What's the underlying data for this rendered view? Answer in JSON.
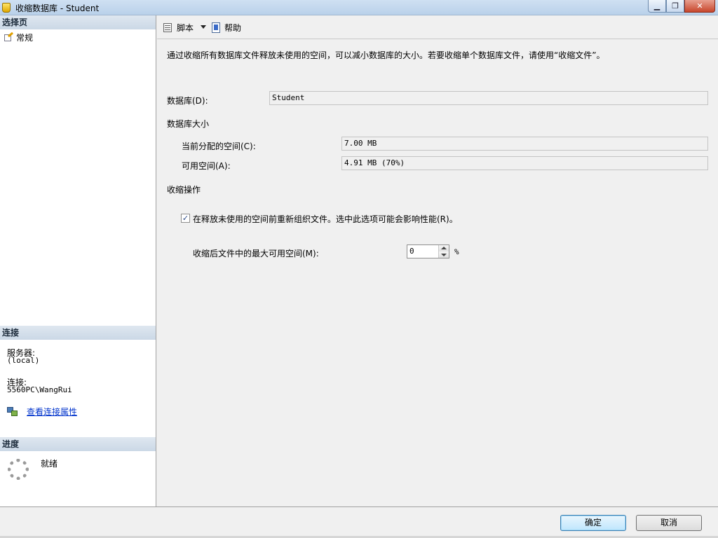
{
  "window": {
    "title": "收缩数据库 - Student",
    "min_glyph": "▁",
    "max_glyph": "❐",
    "close_glyph": "✕"
  },
  "left": {
    "select_page_header": "选择页",
    "pages": [
      {
        "label": "常规"
      }
    ],
    "connection_header": "连接",
    "server_label": "服务器:",
    "server_value": "(local)",
    "connection_label": "连接:",
    "connection_value": "5560PC\\WangRui",
    "view_properties_link": "查看连接属性",
    "progress_header": "进度",
    "progress_status": "就绪"
  },
  "toolbar": {
    "script_label": "脚本",
    "help_label": "帮助"
  },
  "main": {
    "description": "通过收缩所有数据库文件释放未使用的空间，可以减小数据库的大小。若要收缩单个数据库文件，请使用“收缩文件”。",
    "database_label": "数据库(D):",
    "database_value": "Student",
    "size_section": "数据库大小",
    "allocated_label": "当前分配的空间(C):",
    "allocated_value": "7.00 MB",
    "available_label": "可用空间(A):",
    "available_value": "4.91 MB (70%)",
    "shrink_section": "收缩操作",
    "reorganize_checked": true,
    "reorganize_check_glyph": "✓",
    "reorganize_label": "在释放未使用的空间前重新组织文件。选中此选项可能会影响性能(R)。",
    "max_free_label": "收缩后文件中的最大可用空间(M):",
    "max_free_value": "0",
    "max_free_unit": "%"
  },
  "buttons": {
    "ok": "确定",
    "cancel": "取消"
  },
  "colors": {
    "link": "#0033cc",
    "header_bg": "#cbd8e6",
    "default_button": "#bee6fd"
  },
  "icons": [
    "app-db-icon",
    "page-general-icon",
    "script-icon",
    "dropdown-arrow-icon",
    "help-icon",
    "connection-properties-icon",
    "progress-spinner-icon"
  ]
}
